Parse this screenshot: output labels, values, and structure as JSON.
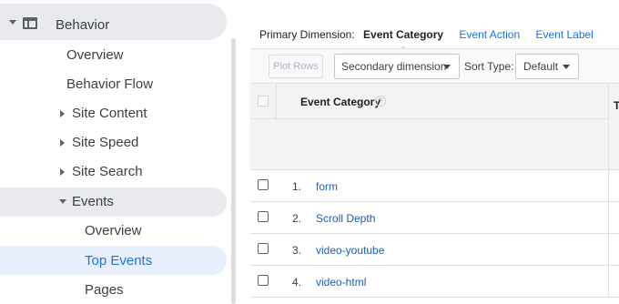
{
  "sidebar": {
    "section_label": "Behavior",
    "items": {
      "overview": "Overview",
      "behavior_flow": "Behavior Flow",
      "site_content": "Site Content",
      "site_speed": "Site Speed",
      "site_search": "Site Search",
      "events": "Events",
      "events_overview": "Overview",
      "top_events": "Top Events",
      "pages": "Pages"
    }
  },
  "dimensions": {
    "label": "Primary Dimension:",
    "current": "Event Category",
    "options": [
      "Event Action",
      "Event Label"
    ]
  },
  "toolbar": {
    "plot_rows": "Plot Rows",
    "secondary_dimension": "Secondary dimension",
    "sort_type_label": "Sort Type:",
    "sort_type_value": "Default"
  },
  "table": {
    "column_header": "Event Category",
    "next_column_header": "T",
    "help_glyph": "?",
    "rows": [
      {
        "num": "1.",
        "label": "form"
      },
      {
        "num": "2.",
        "label": "Scroll Depth"
      },
      {
        "num": "3.",
        "label": "video-youtube"
      },
      {
        "num": "4.",
        "label": "video-html"
      }
    ]
  },
  "colors": {
    "accent_link": "#1a73e8",
    "active_nav_bg": "#e8f0fe",
    "section_bg": "#e8eaed"
  }
}
